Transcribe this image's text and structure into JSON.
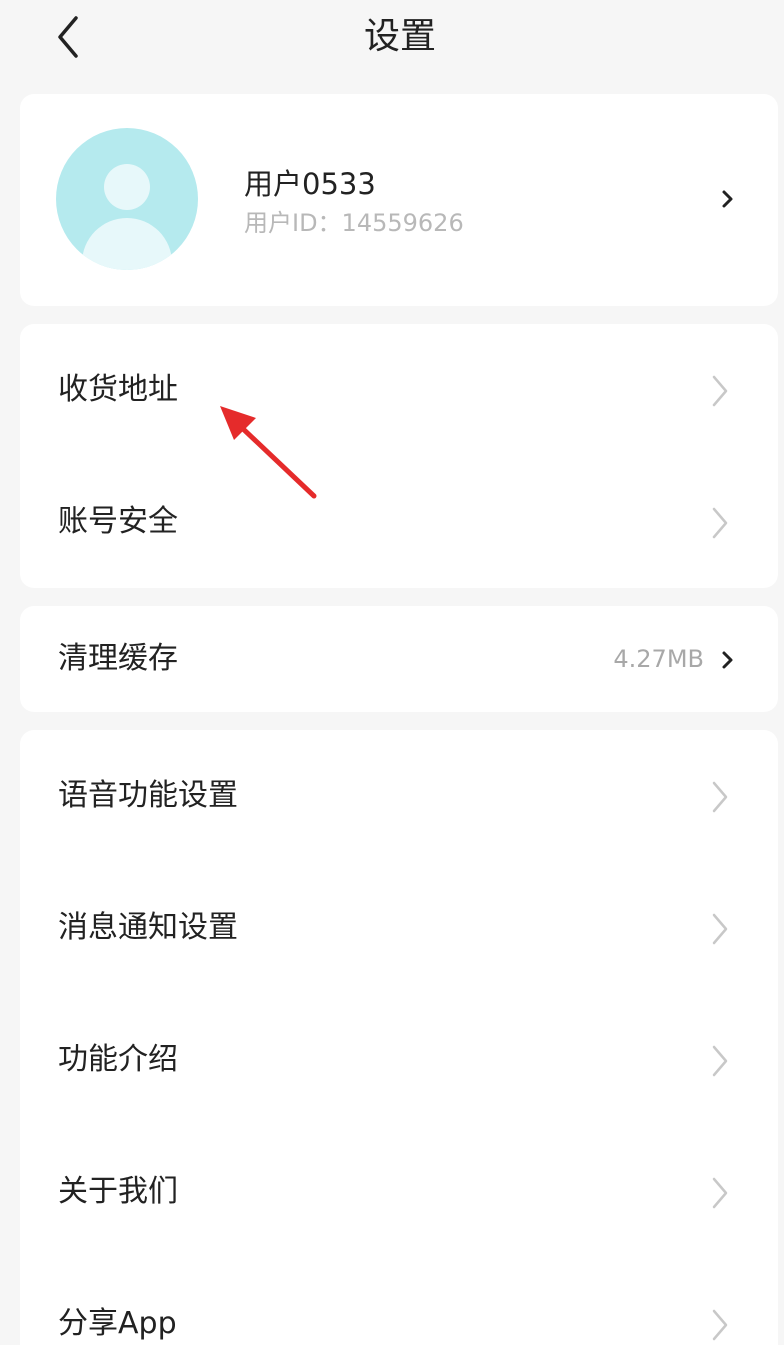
{
  "header": {
    "title": "设置",
    "back_icon": "chevron-left-icon"
  },
  "profile": {
    "name": "用户0533",
    "id_text": "用户ID：14559626",
    "avatar_color": "#b5eaee"
  },
  "groups": {
    "address": "收货地址",
    "security": "账号安全",
    "clear_cache": "清理缓存",
    "cache_size": "4.27MB",
    "voice": "语音功能设置",
    "notifications": "消息通知设置",
    "features": "功能介绍",
    "about": "关于我们",
    "share": "分享App"
  },
  "colors": {
    "background": "#f6f6f6",
    "card": "#ffffff",
    "annotation": "#e52b2b"
  }
}
